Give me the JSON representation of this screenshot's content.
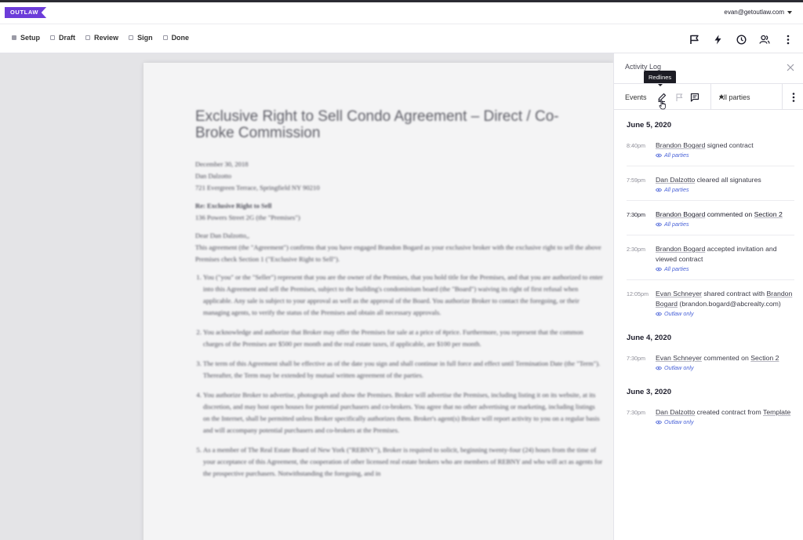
{
  "header": {
    "logo_text": "OUTLAW",
    "user_email": "evan@getoutlaw.com"
  },
  "steps": [
    {
      "label": "Setup",
      "active": true
    },
    {
      "label": "Draft",
      "active": false
    },
    {
      "label": "Review",
      "active": false
    },
    {
      "label": "Sign",
      "active": false
    },
    {
      "label": "Done",
      "active": false
    }
  ],
  "toolbar_icons": [
    "flag-icon",
    "lightning-icon",
    "clock-icon",
    "users-icon",
    "more-vertical-icon"
  ],
  "document": {
    "title": "Exclusive Right to Sell Condo Agreement – Direct / Co-Broke Commission",
    "date": "December 30, 2018",
    "recipient": "Dan Dalzotto",
    "address": "721 Evergreen Terrace, Springfield NY 90210",
    "re_line": "Re: Exclusive Right to Sell",
    "premises": "136 Powers Street 2G (the \"Premises\")",
    "salutation": "Dear Dan Dalzotto,,",
    "intro": "This agreement (the \"Agreement\") confirms that you have engaged Brandon Bogard as your exclusive broker with the exclusive right to sell the above Premises check Section 1 (\"Exclusive Right to Sell\").",
    "clauses": [
      "You (\"you\" or the \"Seller\") represent that you are the owner of the Premises, that you hold title for the Premises, and that you are authorized to enter into this Agreement and sell the Premises, subject to the building's condominium board (the \"Board\") waiving its right of first refusal when applicable. Any sale is subject to your approval as well as the approval of the Board. You authorize Broker to contact the foregoing, or their managing agents, to verify the status of the Premises and obtain all necessary approvals.",
      "You acknowledge and authorize that Broker may offer the Premises for sale at a price of #price. Furthermore, you represent that the common charges of the Premises are $500 per month and the real estate taxes, if applicable, are $100 per month.",
      "The term of this Agreement shall be effective as of the date you sign and shall continue in full force and effect until Termination Date (the \"Term\"). Thereafter, the Term may be extended by mutual written agreement of the parties.",
      "You authorize Broker to advertise, photograph and show the Premises. Broker will advertise the Premises, including listing it on its website, at its discretion, and may host open houses for potential purchasers and co-brokers. You agree that no other advertising or marketing, including listings on the Internet, shall be permitted unless Broker specifically authorizes them. Broker's agent(s) Broker will report activity to you on a regular basis and will accompany potential purchasers and co-brokers at the Premises.",
      "As a member of The Real Estate Board of New York (\"REBNY\"), Broker is required to solicit, beginning twenty-four (24) hours from the time of your acceptance of this Agreement, the cooperation of other licensed real estate brokers who are members of REBNY and who will act as agents for the prospective purchasers. Notwithstanding the foregoing, and in"
    ]
  },
  "activity_panel": {
    "title": "Activity Log",
    "tooltip": "Redlines",
    "filter_label": "Events",
    "parties_select": "All parties",
    "days": [
      {
        "date": "June 5, 2020",
        "entries": [
          {
            "time": "8:40pm",
            "actor": "Brandon Bogard",
            "action": " signed contract",
            "visibility": "All parties",
            "dark": false
          },
          {
            "time": "7:59pm",
            "actor": "Dan Dalzotto",
            "action": " cleared all signatures",
            "visibility": "All parties",
            "dark": false
          },
          {
            "time": "7:30pm",
            "actor": "Brandon Bogard",
            "action": " commented on ",
            "target": "Section 2",
            "visibility": "All parties",
            "dark": true
          },
          {
            "time": "2:30pm",
            "actor": "Brandon Bogard",
            "action": " accepted invitation and viewed contract",
            "visibility": "All parties",
            "dark": false
          },
          {
            "time": "12:05pm",
            "actor": "Evan Schneyer",
            "action": " shared contract with ",
            "target": "Brandon Bogard",
            "extra": " (brandon.bogard@abcrealty.com)",
            "visibility": "Outlaw only",
            "dark": false
          }
        ]
      },
      {
        "date": "June 4, 2020",
        "entries": [
          {
            "time": "7:30pm",
            "actor": "Evan Schneyer",
            "action": " commented on ",
            "target": "Section 2",
            "visibility": "Outlaw only",
            "dark": false
          }
        ]
      },
      {
        "date": "June 3, 2020",
        "entries": [
          {
            "time": "7:30pm",
            "actor": "Dan Dalzotto",
            "action": " created contract from ",
            "target": "Template",
            "visibility": "Outlaw only",
            "dark": false
          }
        ]
      }
    ]
  },
  "colors": {
    "brand": "#6c3cd9",
    "link_blue": "#4a63d8",
    "canvas_gray": "#e4e4e7"
  }
}
